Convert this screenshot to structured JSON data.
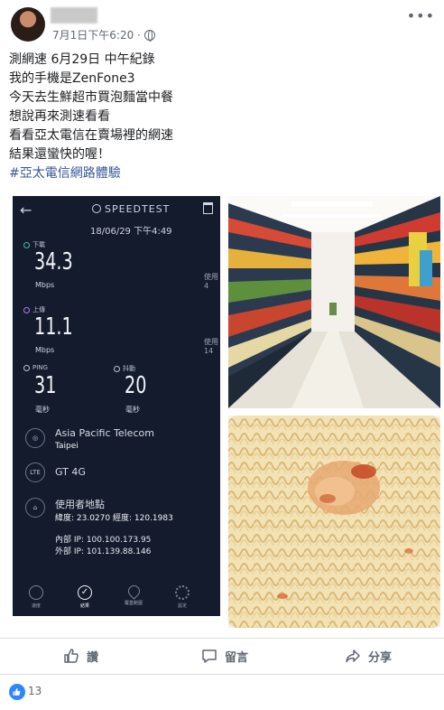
{
  "post": {
    "time": "7月1日下午6:20 ·",
    "more": "•••",
    "lines": [
      "測網速 6月29日 中午紀錄",
      "我的手機是ZenFone3",
      "今天去生鮮超市買泡麵當中餐",
      "想說再來測速看看",
      "看看亞太電信在賣場裡的網速",
      "結果還蠻快的喔！"
    ],
    "hashtag": "#亞太電信網路體驗"
  },
  "speedtest": {
    "logo": "SPEEDTEST",
    "datetime": "18/06/29 下午4:49",
    "download_label": "下載",
    "download_value": "34.3",
    "download_unit": "Mbps",
    "upload_label": "上傳",
    "upload_value": "11.1",
    "upload_unit": "Mbps",
    "ping_label": "PING",
    "ping_value": "31",
    "ping_unit": "毫秒",
    "jitter_label": "抖動",
    "jitter_value": "20",
    "jitter_unit": "毫秒",
    "side_use_1": "使用",
    "side_num_1": "4",
    "side_use_2": "使用",
    "side_num_2": "14",
    "provider": "Asia Pacific Telecom",
    "provider_city": "Taipei",
    "network_icon": "LTE",
    "network": "GT 4G",
    "location_label": "使用者地點",
    "coordinates": "緯度: 23.0270 經度: 120.1983",
    "internal_ip": "內部 IP: 100.100.173.95",
    "external_ip": "外部 IP: 101.139.88.146",
    "nav": [
      "速度",
      "結果",
      "覆蓋範圍",
      "設定"
    ]
  },
  "actions": {
    "like": "讚",
    "comment": "留言",
    "share": "分享"
  },
  "reactions": {
    "count": "13"
  },
  "colors": {
    "link": "#385898",
    "like_blue": "#2d88ff",
    "speedtest_bg": "#141b2d"
  }
}
